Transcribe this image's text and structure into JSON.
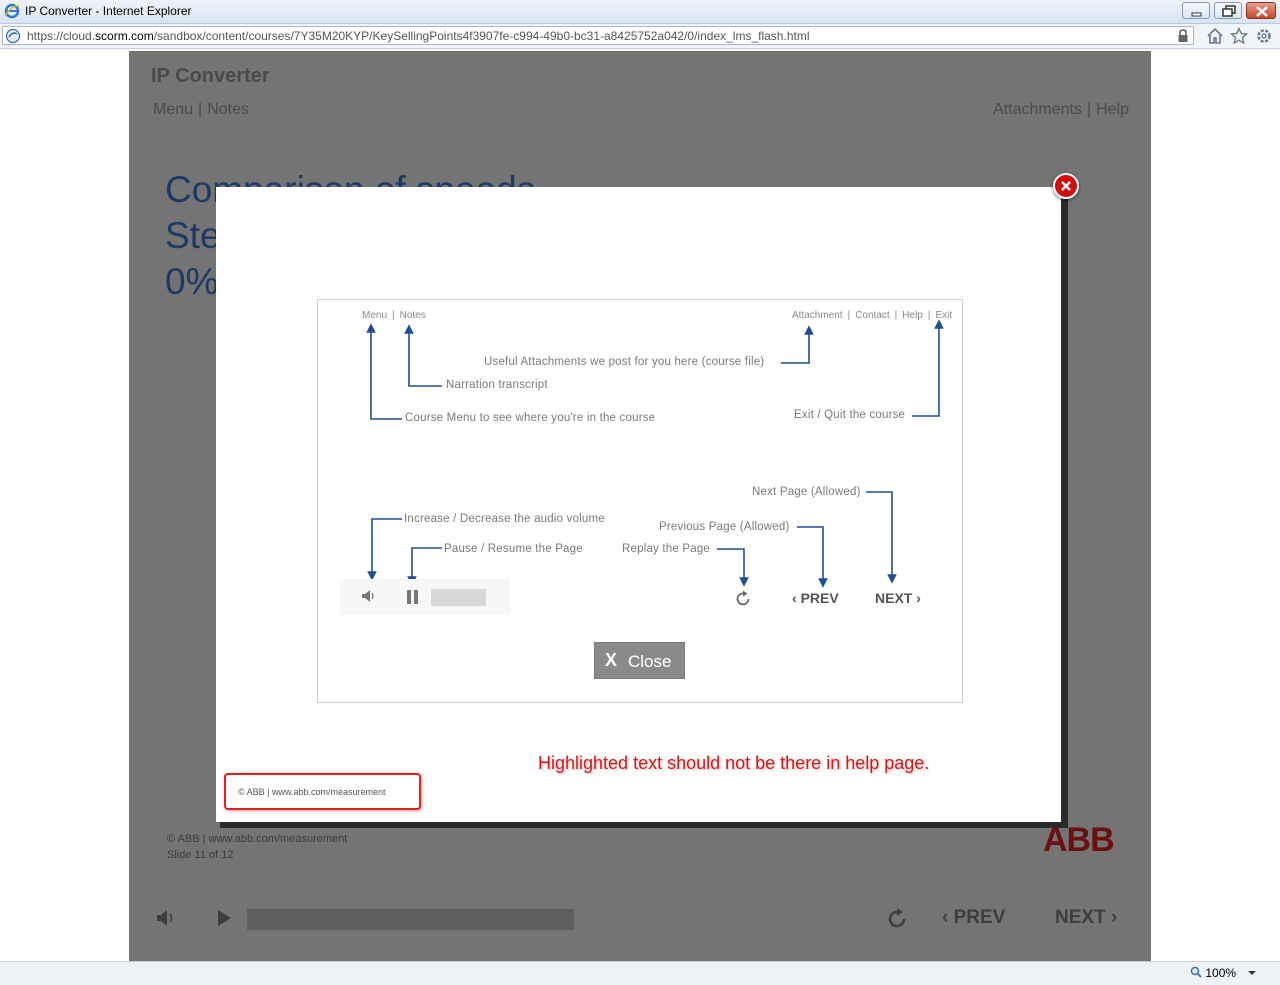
{
  "browser": {
    "window_title": "IP Converter - Internet Explorer",
    "url_prefix": "https://cloud.",
    "url_domain": "scorm.com",
    "url_path": "/sandbox/content/courses/7Y35M20KYP/KeySellingPoints4f3907fe-c994-49b0-bc31-a8425752a042/0/index_lms_flash.html",
    "zoom": "100%"
  },
  "course": {
    "title": "IP Converter",
    "nav_left": [
      "Menu",
      "Notes"
    ],
    "nav_right": [
      "Attachments",
      "Help"
    ],
    "slide_title_lines": [
      "Comparison of speeds",
      "Ste",
      "0%"
    ],
    "footer_copyright": "© ABB | www.abb.com/measurement",
    "slide_counter": "Slide 11 of 12",
    "logo": "ABB",
    "prev_label": "PREV",
    "next_label": "NEXT"
  },
  "help": {
    "top_menu_left": [
      "Menu",
      "Notes"
    ],
    "top_menu_right": [
      "Attachment",
      "Contact",
      "Help",
      "Exit"
    ],
    "attachments_desc": "Useful Attachments we post for you here (course file)",
    "notes_desc": "Narration transcript",
    "menu_desc": "Course Menu to see where you're in the course",
    "exit_desc": "Exit / Quit the course",
    "next_desc": "Next Page (Allowed)",
    "volume_desc": "Increase / Decrease the audio volume",
    "previous_desc": "Previous Page (Allowed)",
    "pause_desc": "Pause / Resume the Page",
    "replay_desc": "Replay the Page",
    "prev_label": "PREV",
    "next_label": "NEXT",
    "close_label": "Close",
    "close_x": "X",
    "footer_copyright": "© ABB | www.abb.com/measurement"
  },
  "annotation": {
    "text": "Highlighted text should not be there in help page.",
    "color": "#d01818"
  },
  "colors": {
    "arrow": "#1f4e99",
    "slide_title": "#1c3a66",
    "overlay": "#747474",
    "modal_close": "#d01010"
  },
  "icons": [
    "ie-logo-icon",
    "minimize-icon",
    "maximize-icon",
    "close-icon",
    "site-icon",
    "lock-icon",
    "home-icon",
    "star-icon",
    "gear-icon",
    "speaker-icon",
    "play-icon",
    "pause-icon",
    "replay-icon",
    "chevron-left-icon",
    "chevron-right-icon",
    "close-circle-icon",
    "zoom-icon",
    "dropdown-icon"
  ]
}
